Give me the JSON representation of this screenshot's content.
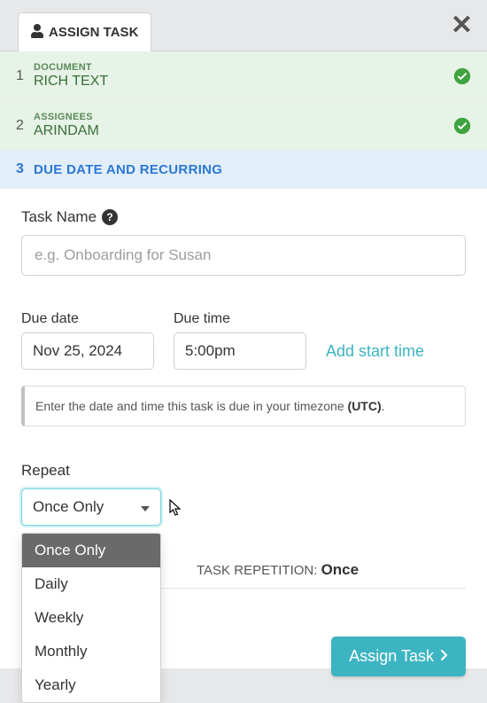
{
  "modal": {
    "tab_label": "ASSIGN TASK"
  },
  "steps": [
    {
      "num": "1",
      "sup": "DOCUMENT",
      "main": "RICH TEXT",
      "done": true
    },
    {
      "num": "2",
      "sup": "ASSIGNEES",
      "main": "ARINDAM",
      "done": true
    },
    {
      "num": "3",
      "sup": "",
      "main": "DUE DATE AND RECURRING",
      "done": false
    }
  ],
  "form": {
    "task_name_label": "Task Name",
    "task_name_placeholder": "e.g. Onboarding for Susan",
    "due_date_label": "Due date",
    "due_date_value": "Nov 25, 2024",
    "due_time_label": "Due time",
    "due_time_value": "5:00pm",
    "add_start_time": "Add start time",
    "hint_text": "Enter the date and time this task is due in your timezone ",
    "hint_tz": "(UTC)",
    "hint_dot": "."
  },
  "repeat": {
    "label": "Repeat",
    "selected": "Once Only",
    "options": [
      "Once Only",
      "Daily",
      "Weekly",
      "Monthly",
      "Yearly"
    ],
    "summary_label": "TASK REPETITION: ",
    "summary_value": "Once"
  },
  "actions": {
    "assign": "Assign Task"
  }
}
